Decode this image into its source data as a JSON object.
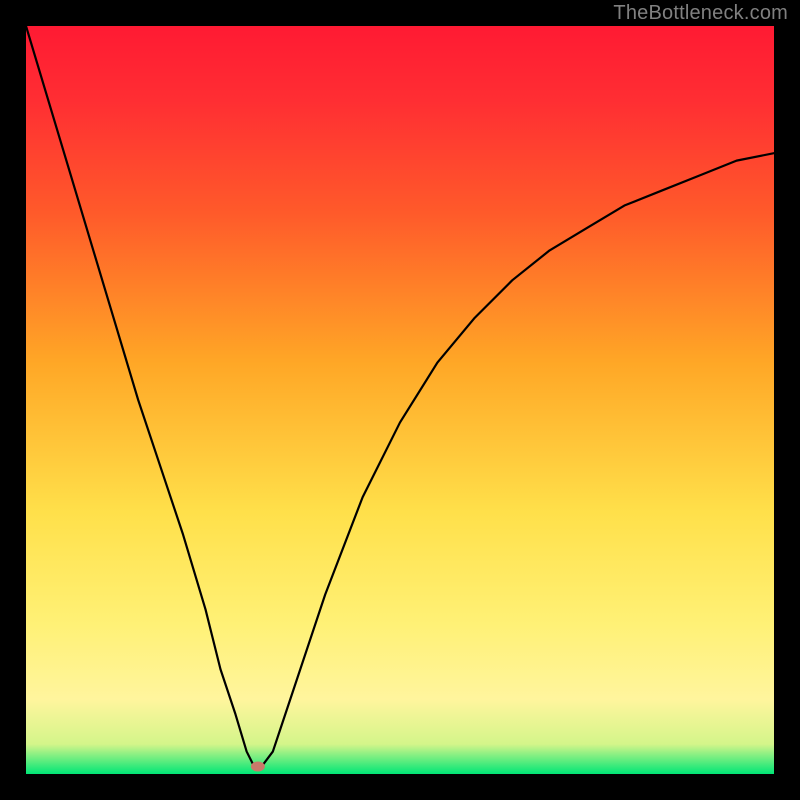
{
  "watermark": "TheBottleneck.com",
  "chart_data": {
    "type": "line",
    "title": "",
    "xlabel": "",
    "ylabel": "",
    "xlim": [
      0,
      100
    ],
    "ylim": [
      0,
      100
    ],
    "grid": false,
    "background_gradient": {
      "top_color": "#ff1a33",
      "mid_colors": [
        "#ff5a2a",
        "#ffa726",
        "#fff176",
        "#fff59d"
      ],
      "bottom_color": "#00e676"
    },
    "series": [
      {
        "name": "bottleneck-curve",
        "type": "line",
        "x": [
          0,
          3,
          6,
          9,
          12,
          15,
          18,
          21,
          24,
          26,
          28,
          29.5,
          30.5,
          31.5,
          33,
          34,
          36,
          40,
          45,
          50,
          55,
          60,
          65,
          70,
          75,
          80,
          85,
          90,
          95,
          100
        ],
        "values": [
          100,
          90,
          80,
          70,
          60,
          50,
          41,
          32,
          22,
          14,
          8,
          3,
          1,
          1,
          3,
          6,
          12,
          24,
          37,
          47,
          55,
          61,
          66,
          70,
          73,
          76,
          78,
          80,
          82,
          83
        ]
      }
    ],
    "marker": {
      "name": "optimal-point",
      "x": 31,
      "y": 1,
      "color": "#c97a6a",
      "rx": 7,
      "ry": 5
    }
  }
}
